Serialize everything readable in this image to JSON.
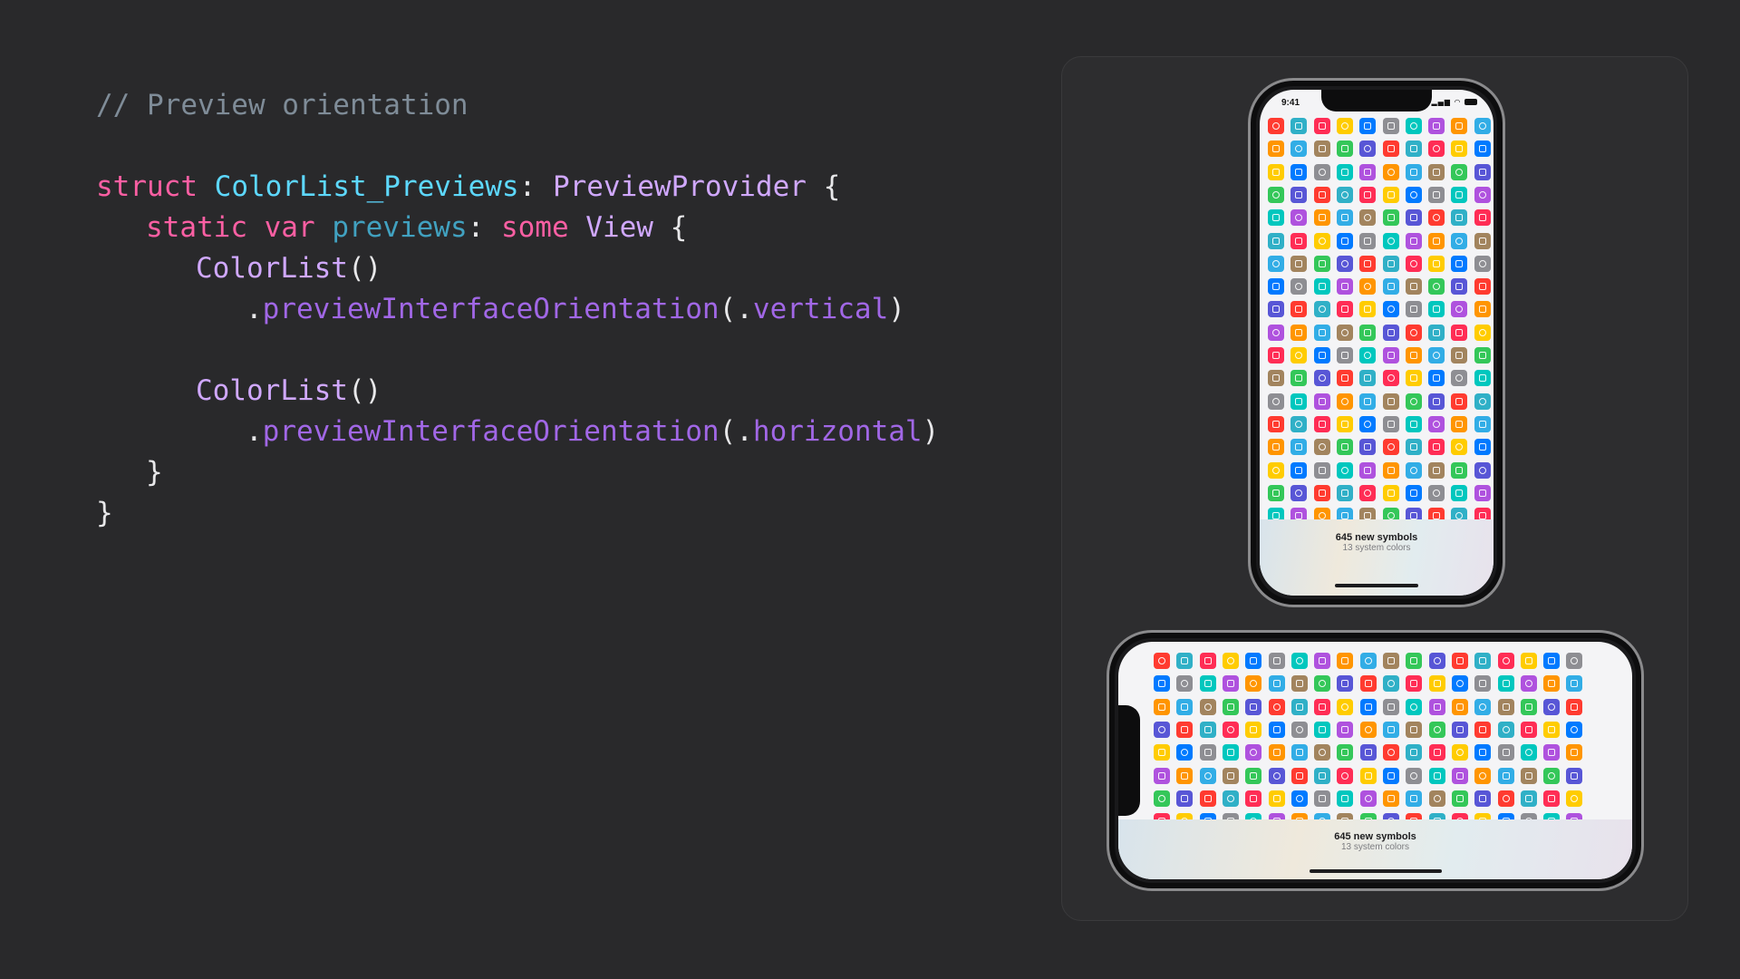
{
  "code": {
    "lines": [
      [
        {
          "cls": "tok-comment",
          "text": "// Preview orientation"
        }
      ],
      [],
      [
        {
          "cls": "tok-keyword",
          "text": "struct "
        },
        {
          "cls": "tok-type",
          "text": "ColorList_Previews"
        },
        {
          "cls": "tok-plain",
          "text": ": "
        },
        {
          "cls": "tok-proto",
          "text": "PreviewProvider"
        },
        {
          "cls": "tok-plain",
          "text": " {"
        }
      ],
      [
        {
          "cls": "tok-keyword",
          "text": "static var "
        },
        {
          "cls": "tok-prop",
          "text": "previews"
        },
        {
          "cls": "tok-plain",
          "text": ": "
        },
        {
          "cls": "tok-keyword",
          "text": "some "
        },
        {
          "cls": "tok-proto",
          "text": "View"
        },
        {
          "cls": "tok-plain",
          "text": " {"
        }
      ],
      [
        {
          "cls": "tok-proto",
          "text": "ColorList"
        },
        {
          "cls": "tok-plain",
          "text": "()"
        }
      ],
      [
        {
          "cls": "tok-plain",
          "text": "."
        },
        {
          "cls": "tok-method",
          "text": "previewInterfaceOrientation"
        },
        {
          "cls": "tok-plain",
          "text": "(."
        },
        {
          "cls": "tok-method",
          "text": "vertical"
        },
        {
          "cls": "tok-plain",
          "text": ")"
        }
      ],
      [],
      [
        {
          "cls": "tok-proto",
          "text": "ColorList"
        },
        {
          "cls": "tok-plain",
          "text": "()"
        }
      ],
      [
        {
          "cls": "tok-plain",
          "text": "."
        },
        {
          "cls": "tok-method",
          "text": "previewInterfaceOrientation"
        },
        {
          "cls": "tok-plain",
          "text": "(."
        },
        {
          "cls": "tok-method",
          "text": "horizontal"
        },
        {
          "cls": "tok-plain",
          "text": ")"
        }
      ],
      [
        {
          "cls": "tok-plain",
          "text": "}"
        }
      ],
      [
        {
          "cls": "tok-plain",
          "text": "}"
        }
      ]
    ]
  },
  "preview": {
    "portrait": {
      "status_time": "9:41",
      "footer_title": "645 new symbols",
      "footer_subtitle": "13 system colors"
    },
    "landscape": {
      "footer_title": "645 new symbols",
      "footer_subtitle": "13 system colors"
    },
    "system_colors": [
      "#ff3b30",
      "#ff9500",
      "#ffcc00",
      "#34c759",
      "#00c7be",
      "#30b0c7",
      "#32ade6",
      "#007aff",
      "#5856d6",
      "#af52de",
      "#ff2d55",
      "#a2845e",
      "#8e8e93"
    ]
  },
  "colors": {
    "background": "#29292b",
    "canvas": "#2d2d2f",
    "keyword": "#fc5fa3",
    "type": "#5dd8ff",
    "method": "#a167e6"
  }
}
